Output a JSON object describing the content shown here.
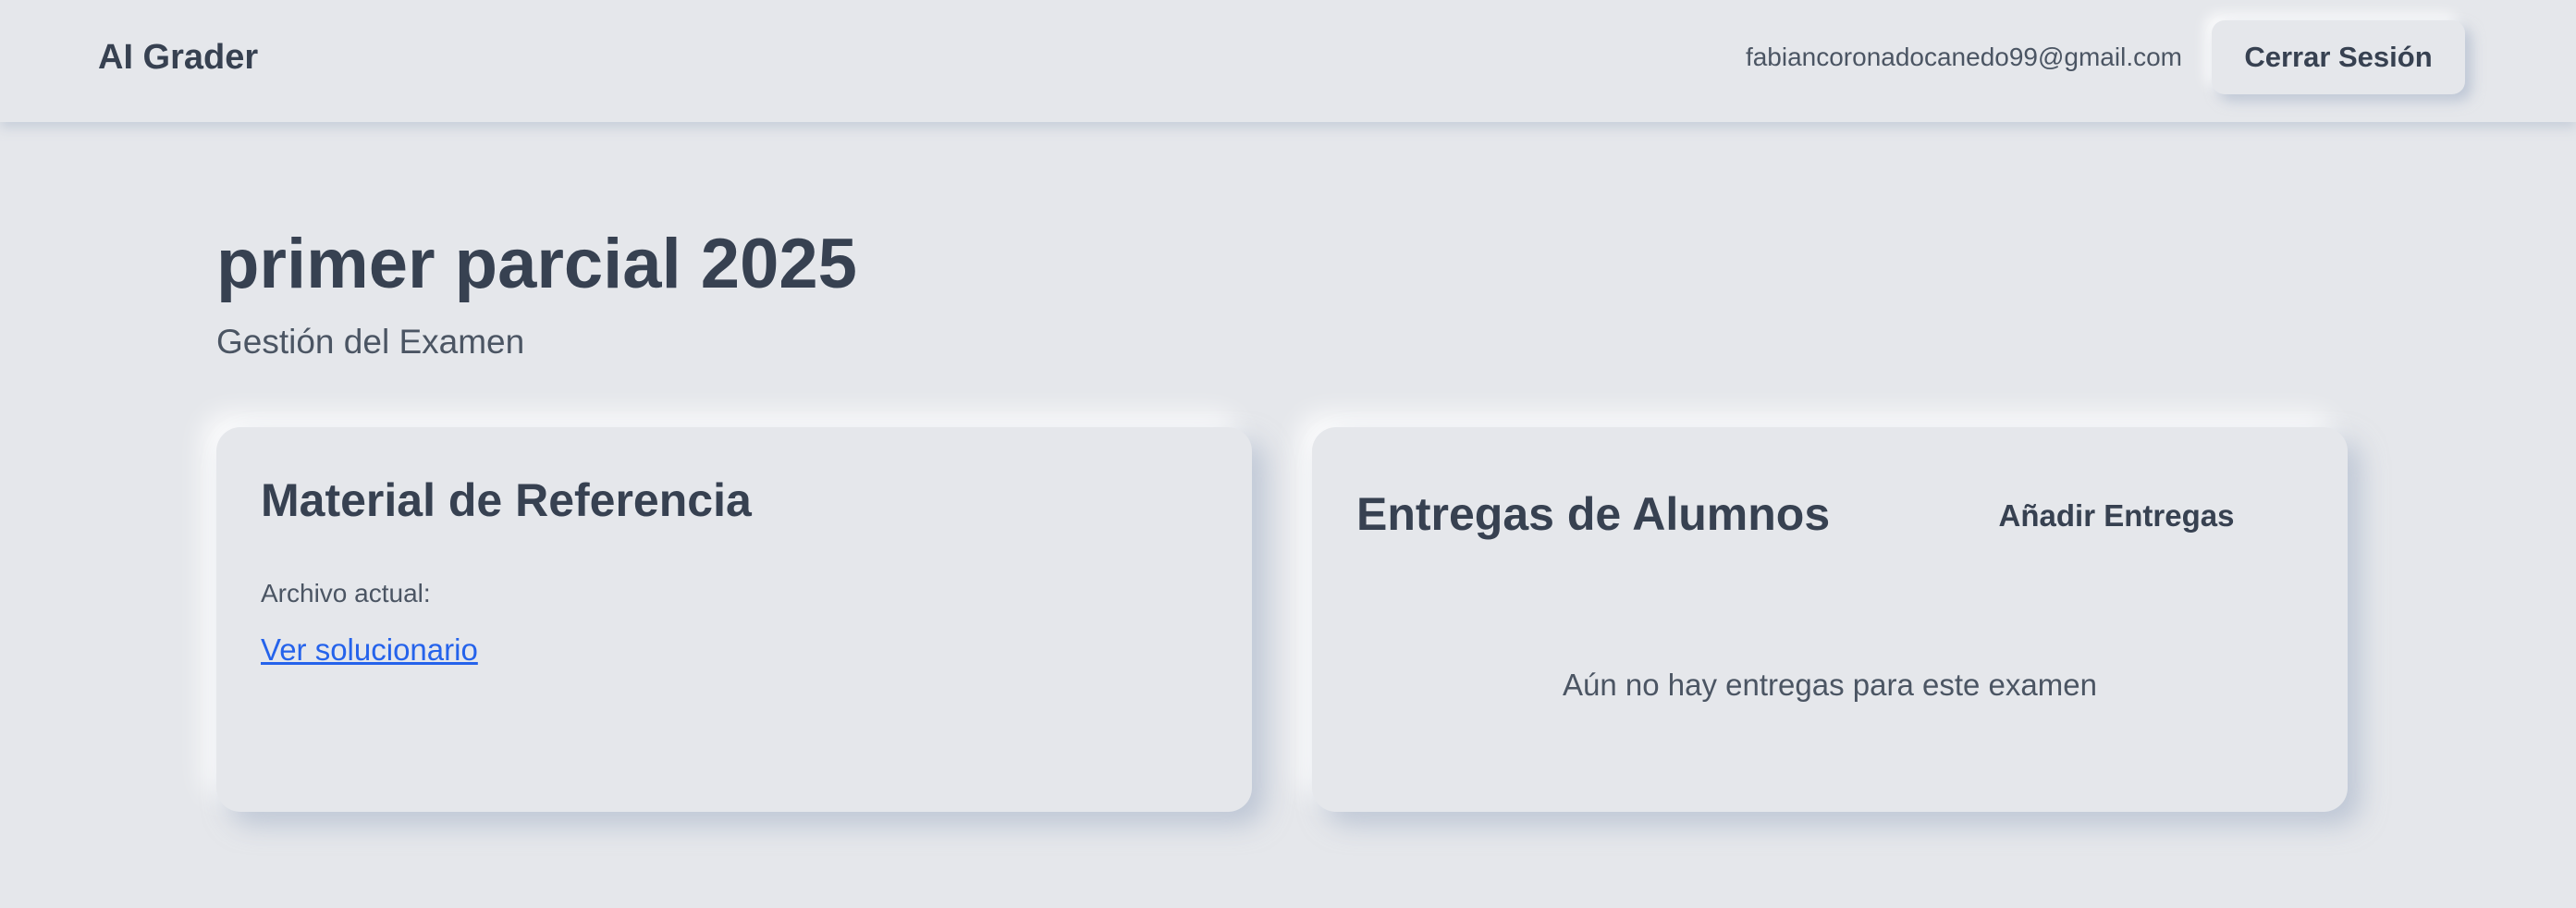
{
  "navbar": {
    "brand": "AI Grader",
    "user_email": "fabiancoronadocanedo99@gmail.com",
    "logout_label": "Cerrar Sesión"
  },
  "header": {
    "title": "primer parcial 2025",
    "subtitle": "Gestión del Examen"
  },
  "reference_card": {
    "title": "Material de Referencia",
    "file_label": "Archivo actual:",
    "file_link": "Ver solucionario"
  },
  "submissions_card": {
    "title": "Entregas de Alumnos",
    "add_label": "Añadir Entregas",
    "empty_message": "Aún no hay entregas para este examen"
  },
  "colors": {
    "background": "#e5e7eb",
    "text": "#374151",
    "muted_text": "#4b5563",
    "link": "#2563eb"
  }
}
